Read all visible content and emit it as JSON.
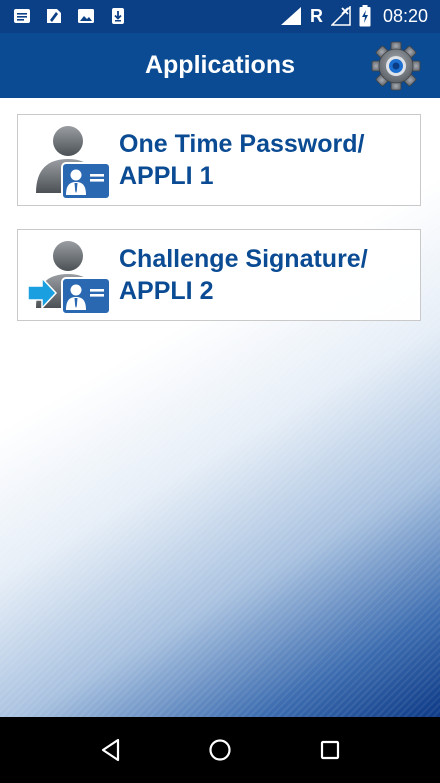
{
  "status_bar": {
    "time": "08:20",
    "network_letter": "R",
    "icons": [
      "notes-icon",
      "sim-edit-icon",
      "image-icon",
      "download-icon",
      "signal-icon",
      "no-data-icon",
      "battery-charging-icon"
    ]
  },
  "app_bar": {
    "title": "Applications",
    "settings_icon": "gear-icon"
  },
  "applications": [
    {
      "line1": "One Time Password/",
      "line2": "APPLI 1",
      "icon": "user-id-card-icon"
    },
    {
      "line1": "Challenge Signature/",
      "line2": "APPLI 2",
      "icon": "user-id-card-arrow-icon"
    }
  ],
  "nav_bar": {
    "icons": [
      "back-icon",
      "home-icon",
      "recent-apps-icon"
    ]
  },
  "colors": {
    "primary": "#0a4b93",
    "status_bar": "#0b3f86",
    "accent_cyan": "#1aa0e0"
  }
}
